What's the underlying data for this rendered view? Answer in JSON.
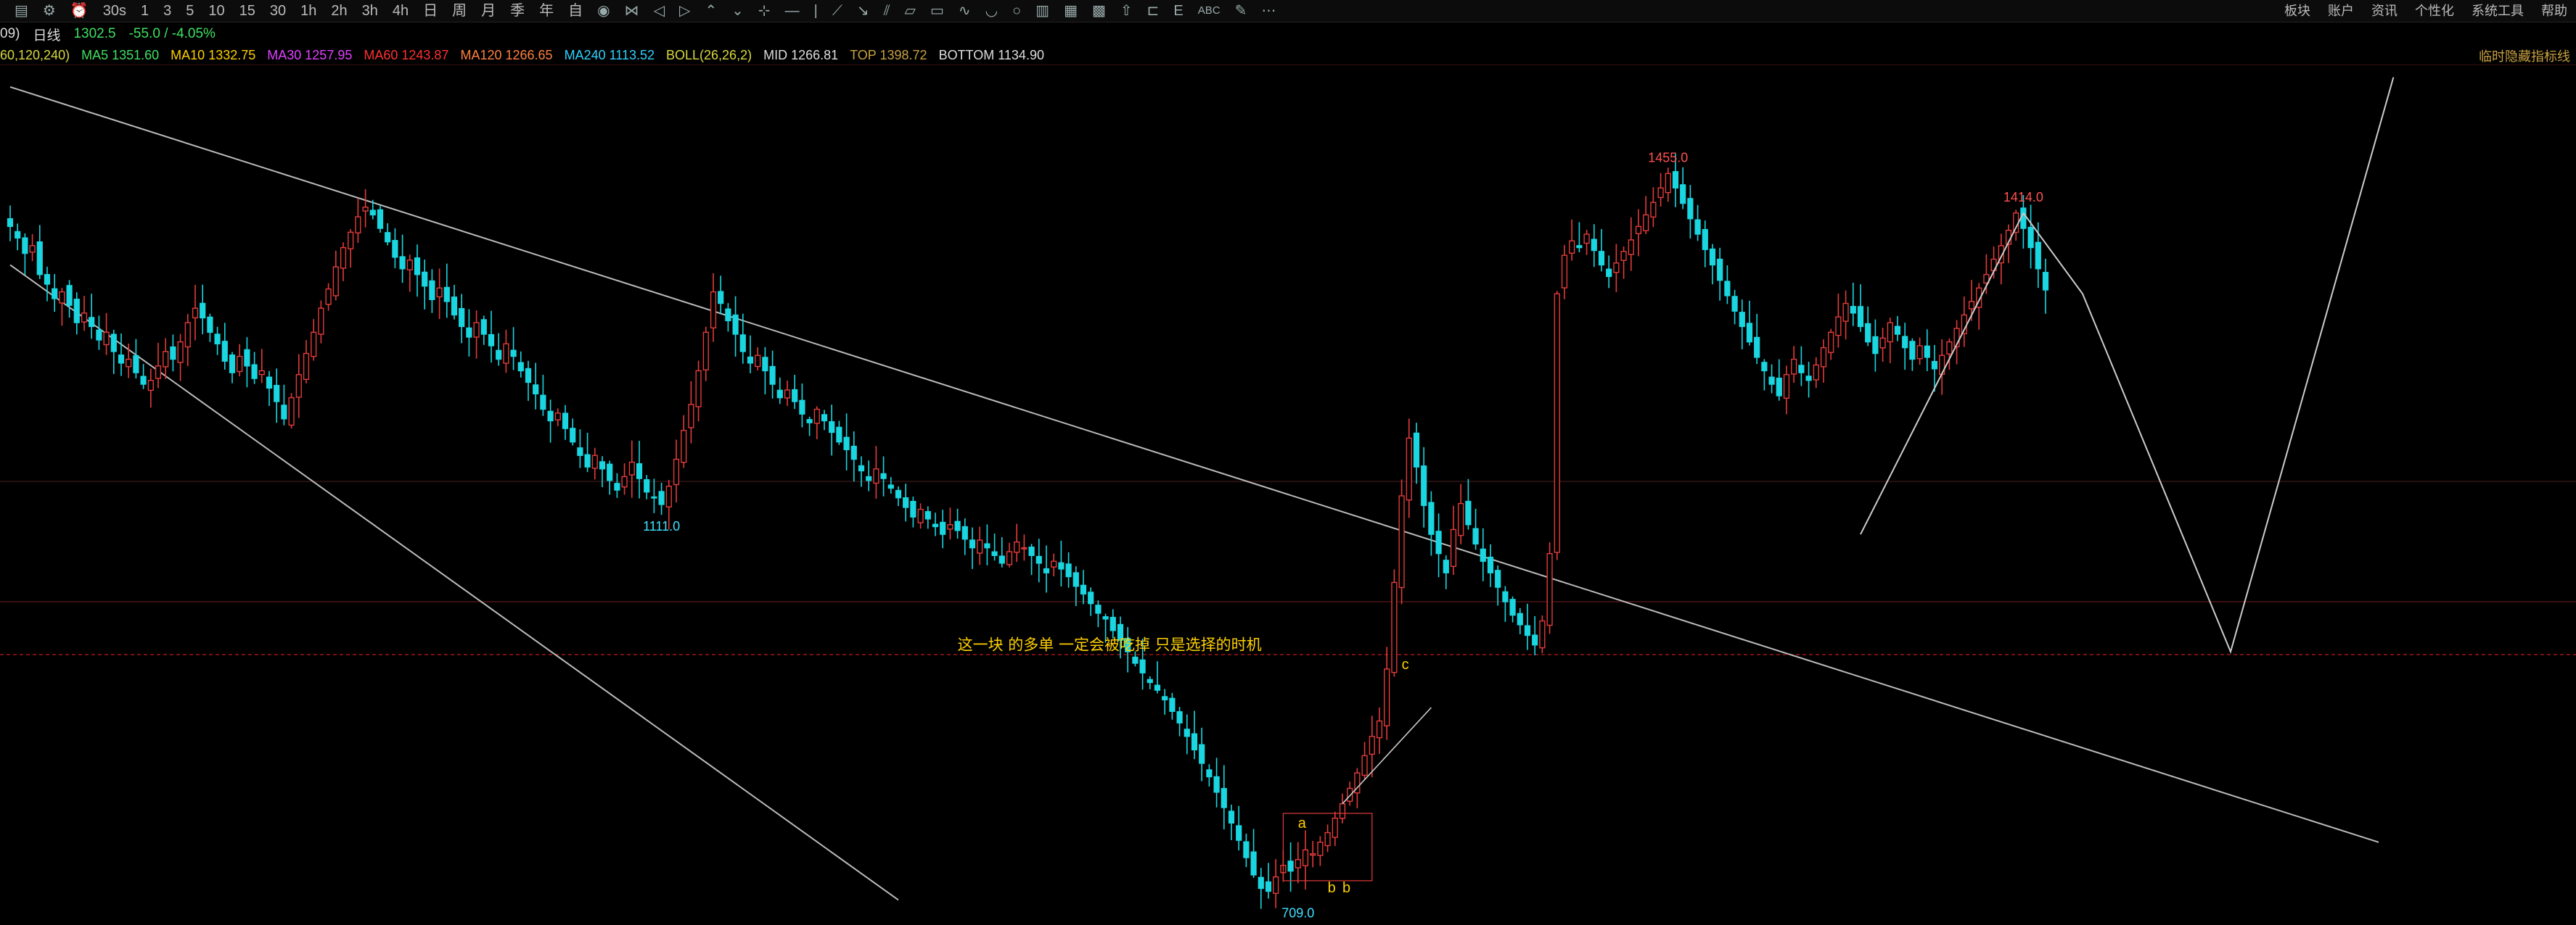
{
  "toolbar": {
    "left_items": [
      "30s",
      "1",
      "3",
      "5",
      "10",
      "15",
      "30",
      "1h",
      "2h",
      "3h",
      "4h",
      "日",
      "周",
      "月",
      "季",
      "年",
      "自"
    ],
    "left_icons": [
      "layout-icon",
      "settings-icon",
      "alarm-icon"
    ],
    "draw_icons": [
      "eye-icon",
      "shape-icon",
      "back-icon",
      "forward-icon",
      "arrows-up-icon",
      "arrows-down-icon",
      "cursor-icon",
      "line-icon",
      "vline-icon",
      "wave-icon",
      "ray-icon",
      "trend-icon",
      "parallel-icon",
      "rect-icon",
      "wave2-icon",
      "arc-icon",
      "circle-icon",
      "fib-icon",
      "channel-icon",
      "grid-icon",
      "arrow-icon",
      "measure-icon",
      "text-icon",
      "abc-icon",
      "pencil-icon",
      "more-icon"
    ],
    "abc_label": "ABC",
    "more_label": "⋯",
    "right_items": [
      "板块",
      "账户",
      "资讯",
      "个性化",
      "系统工具",
      "帮助"
    ]
  },
  "quote": {
    "code_fragment": "09)",
    "period": "日线",
    "price": "1302.5",
    "change": "-55.0 / -4.05%"
  },
  "indicators": {
    "ma_params": "60,120,240)",
    "ma5": "MA5 1351.60",
    "ma10": "MA10 1332.75",
    "ma30": "MA30 1257.95",
    "ma60": "MA60 1243.87",
    "ma120": "MA120 1266.65",
    "ma240": "MA240 1113.52",
    "boll_name": "BOLL(26,26,2)",
    "boll_mid": "MID 1266.81",
    "boll_top": "TOP 1398.72",
    "boll_bottom": "BOTTOM 1134.90",
    "right_label": "临时隐藏指标线"
  },
  "colors": {
    "up": "#e23b3b",
    "down": "#19d6e0",
    "ma5": "#ffffff",
    "ma10": "#ffd000",
    "ma30": "#e040ff",
    "ma60": "#ff3030",
    "ma120": "#ff8040",
    "ma240": "#30d0ff",
    "boll": "#d8d840",
    "mid": "#dddddd",
    "top": "#c8a040",
    "bottom": "#dddddd",
    "label_red": "#ff5050",
    "label_cyan": "#40e0ff",
    "annotation": "#ffd000"
  },
  "chart_data": {
    "type": "candlestick",
    "y_unit": "price",
    "ylim": [
      680,
      1560
    ],
    "grid": false,
    "price_labels": [
      {
        "text": "1111.0",
        "bar": 88,
        "price": 1111.0,
        "color": "cyan"
      },
      {
        "text": "709.0",
        "bar": 174,
        "price": 709.0,
        "color": "cyan"
      },
      {
        "text": "1455.0",
        "bar": 224,
        "price": 1455.0,
        "color": "red"
      },
      {
        "text": "1414.0",
        "bar": 272,
        "price": 1414.0,
        "color": "red"
      }
    ],
    "annotation": "这一块 的多单 一定会被吃掉 只是选择的时机",
    "wave_labels": [
      "a",
      "b",
      "b",
      "c"
    ],
    "closes_every_bar": [
      1400,
      1388,
      1372,
      1380,
      1350,
      1340,
      1325,
      1332,
      1318,
      1300,
      1310,
      1296,
      1282,
      1290,
      1270,
      1258,
      1262,
      1248,
      1236,
      1240,
      1255,
      1270,
      1262,
      1280,
      1300,
      1315,
      1305,
      1290,
      1278,
      1260,
      1248,
      1265,
      1255,
      1242,
      1250,
      1232,
      1218,
      1200,
      1222,
      1246,
      1268,
      1290,
      1315,
      1335,
      1358,
      1378,
      1394,
      1410,
      1420,
      1412,
      1398,
      1384,
      1368,
      1356,
      1365,
      1350,
      1338,
      1324,
      1336,
      1322,
      1308,
      1296,
      1285,
      1300,
      1288,
      1276,
      1262,
      1278,
      1265,
      1250,
      1238,
      1226,
      1210,
      1198,
      1206,
      1190,
      1176,
      1162,
      1150,
      1162,
      1148,
      1136,
      1126,
      1140,
      1155,
      1138,
      1124,
      1118,
      1111,
      1130,
      1158,
      1188,
      1215,
      1250,
      1290,
      1332,
      1320,
      1302,
      1288,
      1270,
      1258,
      1266,
      1250,
      1236,
      1222,
      1230,
      1218,
      1205,
      1196,
      1210,
      1198,
      1186,
      1176,
      1168,
      1158,
      1146,
      1136,
      1148,
      1138,
      1128,
      1118,
      1108,
      1098,
      1106,
      1096,
      1088,
      1080,
      1090,
      1084,
      1075,
      1066,
      1074,
      1066,
      1058,
      1050,
      1062,
      1072,
      1066,
      1058,
      1050,
      1040,
      1052,
      1044,
      1036,
      1026,
      1018,
      1008,
      998,
      992,
      980,
      970,
      958,
      946,
      936,
      926,
      918,
      908,
      896,
      884,
      870,
      856,
      842,
      828,
      812,
      796,
      780,
      762,
      744,
      726,
      712,
      709,
      724,
      736,
      730,
      742,
      752,
      748,
      760,
      770,
      785,
      800,
      816,
      832,
      850,
      870,
      886,
      940,
      1030,
      1120,
      1180,
      1150,
      1110,
      1080,
      1060,
      1040,
      1085,
      1112,
      1090,
      1070,
      1052,
      1040,
      1025,
      1010,
      996,
      986,
      975,
      965,
      990,
      1060,
      1330,
      1370,
      1385,
      1378,
      1392,
      1375,
      1360,
      1348,
      1362,
      1374,
      1386,
      1400,
      1412,
      1425,
      1440,
      1455,
      1440,
      1424,
      1408,
      1392,
      1376,
      1360,
      1344,
      1328,
      1312,
      1296,
      1280,
      1264,
      1250,
      1236,
      1224,
      1246,
      1262,
      1248,
      1240,
      1256,
      1274,
      1290,
      1306,
      1320,
      1310,
      1296,
      1280,
      1268,
      1284,
      1300,
      1288,
      1274,
      1262,
      1276,
      1264,
      1252,
      1266,
      1280,
      1294,
      1308,
      1322,
      1336,
      1350,
      1366,
      1380,
      1396,
      1414,
      1398,
      1378,
      1356,
      1334
    ],
    "projection": [
      {
        "bar": 272,
        "price": 1414
      },
      {
        "bar": 280,
        "price": 1330
      },
      {
        "bar": 300,
        "price": 958
      },
      {
        "bar": 322,
        "price": 1555
      }
    ],
    "channel": {
      "upper": [
        {
          "bar": 0,
          "price": 1545
        },
        {
          "bar": 320,
          "price": 760
        }
      ],
      "lower": [
        {
          "bar": 0,
          "price": 1360
        },
        {
          "bar": 120,
          "price": 700
        }
      ]
    },
    "trendlines": [
      {
        "from": {
          "bar": 250,
          "price": 1080
        },
        "to": {
          "bar": 272,
          "price": 1414
        }
      }
    ],
    "levels": [
      {
        "price": 955,
        "color": "#7a1010",
        "dash": true
      },
      {
        "price": 1010,
        "color": "#3a1010",
        "dash": false
      },
      {
        "price": 1135,
        "color": "#2a1010",
        "dash": false
      }
    ]
  }
}
